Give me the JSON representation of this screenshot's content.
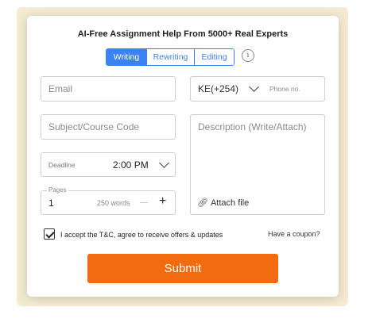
{
  "form": {
    "title": "AI-Free Assignment Help From 5000+ Real Experts",
    "tabs": [
      {
        "label": "Writing",
        "active": true
      },
      {
        "label": "Rewriting",
        "active": false
      },
      {
        "label": "Editing",
        "active": false
      }
    ],
    "info_icon": "info-icon",
    "email": {
      "placeholder": "Email"
    },
    "phone": {
      "country_code": "KE(+254)",
      "placeholder": "Phone no."
    },
    "subject": {
      "placeholder": "Subject/Course Code"
    },
    "description": {
      "placeholder": "Description (Write/Attach)",
      "attach_label": "Attach file"
    },
    "deadline": {
      "label": "Deadline",
      "value": "2:00 PM"
    },
    "pages": {
      "label": "Pages",
      "value": "1",
      "words": "250 words",
      "minus": "—",
      "plus": "+"
    },
    "terms": {
      "checked": true,
      "label": "I accept the T&C, agree to receive offers & updates"
    },
    "coupon_label": "Have a coupon?",
    "submit_label": "Submit"
  },
  "colors": {
    "accent": "#3b82f6",
    "submit": "#f26b0f",
    "frame": "#f4ecd2"
  }
}
